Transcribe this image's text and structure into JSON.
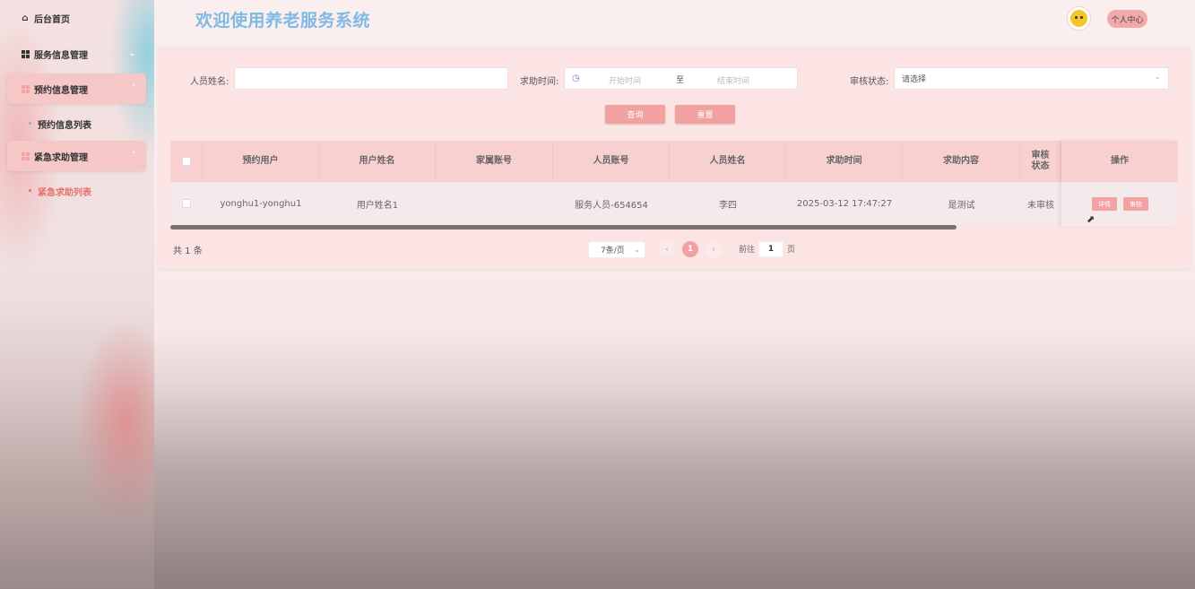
{
  "header": {
    "title": "欢迎使用养老服务系统",
    "profile_label": "个人中心"
  },
  "sidebar": {
    "home": "后台首页",
    "service_mgmt": "服务信息管理",
    "booking_mgmt": "预约信息管理",
    "booking_list": "预约信息列表",
    "emergency_mgmt": "紧急求助管理",
    "emergency_list": "紧急求助列表"
  },
  "search": {
    "name_label": "人员姓名:",
    "name_value": "",
    "time_label": "求助时间:",
    "start_placeholder": "开始时间",
    "range_sep": "至",
    "end_placeholder": "结束时间",
    "status_label": "审核状态:",
    "status_value": "请选择",
    "query_label": "查询",
    "reset_label": "重置"
  },
  "table": {
    "columns": [
      "预约用户",
      "用户姓名",
      "家属账号",
      "人员账号",
      "人员姓名",
      "求助时间",
      "求助内容",
      "审核状态",
      "操作"
    ],
    "rows": [
      {
        "booking_user": "yonghu1-yonghu1",
        "user_name": "用户姓名1",
        "family_account": "",
        "staff_account": "服务人员-654654",
        "staff_name": "李四",
        "help_time": "2025-03-12 17:47:27",
        "help_content": "是测试",
        "review_status": "未审核",
        "detail_label": "详情",
        "review_label": "审核"
      }
    ]
  },
  "pagination": {
    "total_text": "共 1 条",
    "page_size": "7条/页",
    "current_page": "1",
    "goto_prefix": "前往",
    "goto_value": "1",
    "goto_suffix": "页"
  },
  "colors": {
    "accent": "#f2a1a1",
    "title": "#7fb9e6",
    "active_link": "#e8706d"
  }
}
